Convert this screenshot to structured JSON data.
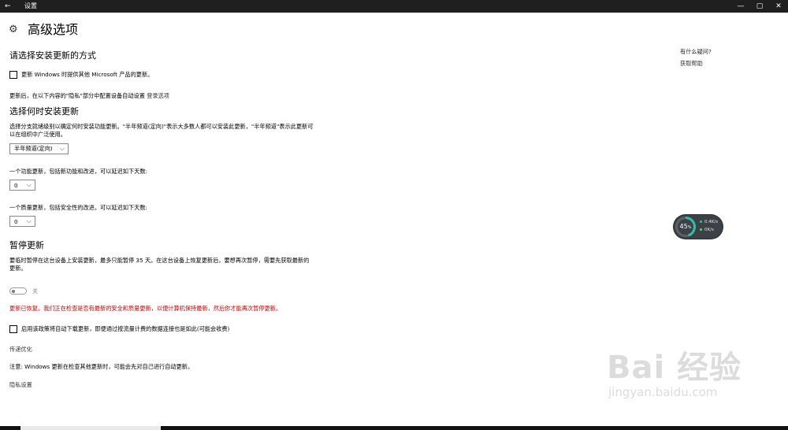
{
  "window": {
    "title": "设置",
    "back_icon": "←",
    "minimize_icon": "—",
    "maximize_icon": "▢",
    "close_icon": "✕"
  },
  "page": {
    "title": "高级选项",
    "gear_icon": "⚙"
  },
  "section_install_method": {
    "heading": "请选择安装更新的方式",
    "checkbox_label": "更新 Windows 时提供其他 Microsoft 产品的更新。",
    "checked": false,
    "signin_text": "更新后，在以下内容的\"隐私\"部分中配置设备自动设置",
    "signin_link": "登录选项"
  },
  "section_when": {
    "heading": "选择何时安装更新",
    "desc_line1": "选择分支就绪级别以确定何时安装功能更新。\"半年频道(定向)\"表示大多数人都可以安装此更新，\"半年频道\"表示此更新可",
    "desc_line2": "以在组织中广泛使用。",
    "branch_select": "半年频道(定向)",
    "feature_label": "一个功能更新，包括新功能和改进，可以延迟如下天数:",
    "feature_days": "0",
    "quality_label": "一个质量更新，包括安全性的改进。可以延迟如下天数:",
    "quality_days": "0"
  },
  "section_pause": {
    "heading": "暂停更新",
    "desc_line1": "要临时暂停在这台设备上安装更新，最多只能暂停 35 天。在这台设备上恢复更新后，要想再次暂停，需要先获取最新的",
    "desc_line2": "更新。",
    "toggle_state": "关",
    "toggle_on": false,
    "error_text": "更新已恢复。我们正在检查是否有最新的安全和质量更新，以便计算机保持最新，然后你才能再次暂停更新。",
    "error_color": "#d00000"
  },
  "section_other": {
    "metered_label": "启用该政策将自动下载更新，即便通过按流量计费的数据连接也是如此(可能会收费)",
    "metered_checked": false,
    "delivery_link": "传递优化",
    "note": "注意: Windows 更新在检查其他更新时，可能会先对自己进行自动更新。",
    "privacy_link": "隐私设置"
  },
  "help": {
    "title": "有什么疑问?",
    "link": "获取帮助"
  },
  "net_widget": {
    "percent": "45",
    "percent_unit": "%",
    "up_rate": "0.4K/s",
    "down_rate": "0K/s",
    "accent": "#33c0a8"
  },
  "watermark": {
    "main": "Bai 经验",
    "sub": "jingyan.baidu.com"
  }
}
